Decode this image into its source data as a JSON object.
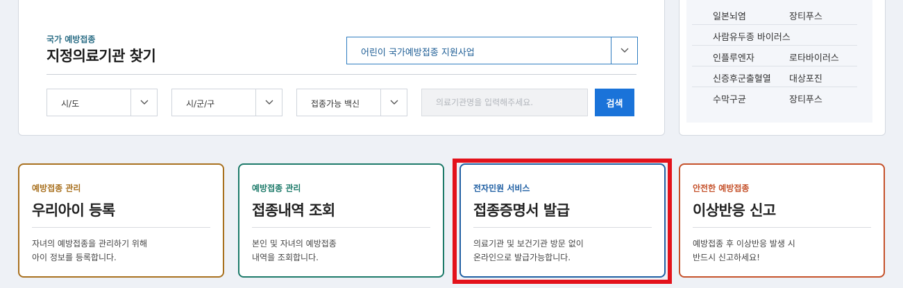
{
  "search": {
    "subtitle": "국가 예방접종",
    "title": "지정의료기관 찾기",
    "program_select": "어린이 국가예방접종 지원사업",
    "sido": "시/도",
    "sigungu": "시/군/구",
    "vaccine": "접종가능 백신",
    "placeholder": "의료기관명을 입력해주세요.",
    "button": "검색"
  },
  "vaccines": [
    [
      "일본뇌염",
      "장티푸스"
    ],
    [
      "사람유두종 바이러스",
      ""
    ],
    [
      "인플루엔자",
      "로타바이러스"
    ],
    [
      "신증후군출혈열",
      "대상포진"
    ],
    [
      "수막구균",
      "장티푸스"
    ]
  ],
  "cards": [
    {
      "category": "예방접종 관리",
      "title": "우리아이 등록",
      "desc1": "자녀의 예방접종을 관리하기 위해",
      "desc2": "아이 정보를 등록합니다.",
      "color": "#a8701e"
    },
    {
      "category": "예방접종 관리",
      "title": "접종내역 조회",
      "desc1": "본인 및 자녀의 예방접종",
      "desc2": "내역을 조회합니다.",
      "color": "#1c7a69"
    },
    {
      "category": "전자민원 서비스",
      "title": "접종증명서 발급",
      "desc1": "의료기관 및 보건기관 방문 없이",
      "desc2": "온라인으로 발급가능합니다.",
      "color": "#1f5fa3"
    },
    {
      "category": "안전한 예방접종",
      "title": "이상반응 신고",
      "desc1": "예방접종 후 이상반응 발생 시",
      "desc2": "반드시 신고하세요!",
      "color": "#c5512a"
    }
  ],
  "icons": {
    "dropdown": "chevron-down-icon"
  }
}
